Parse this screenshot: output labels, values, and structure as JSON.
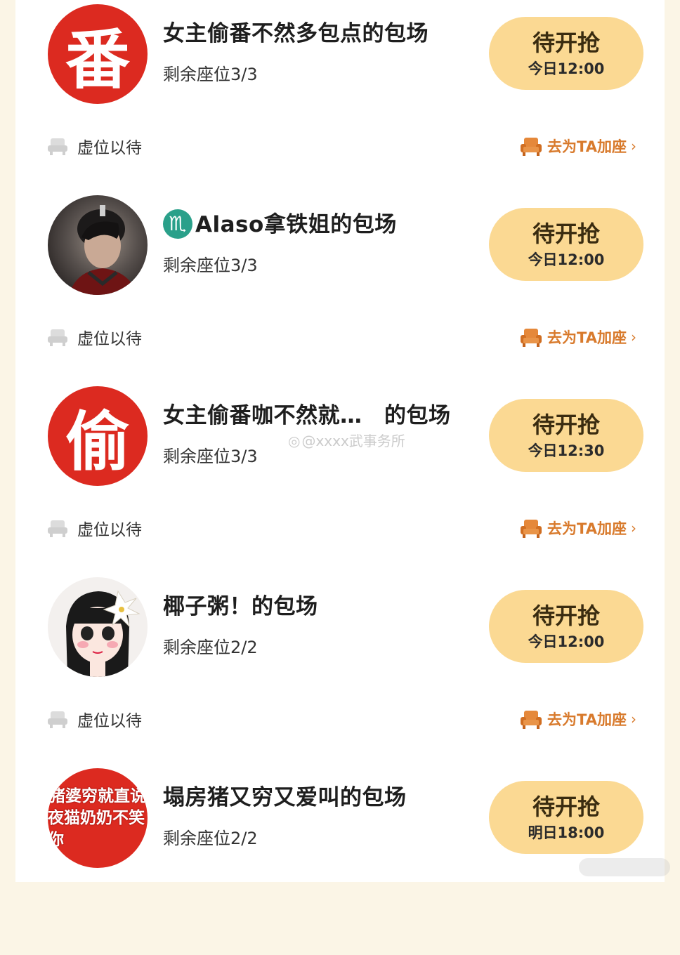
{
  "cards": [
    {
      "avatar_text": "番",
      "title": "女主偷番不然多包点的包场",
      "seats": "剩余座位3/3",
      "button_main": "待开抢",
      "button_time": "今日12:00",
      "vacant_label": "虚位以待",
      "join_label": "去为TA加座"
    },
    {
      "avatar_text": "",
      "title": "Alaso拿铁姐的包场",
      "title_icon": "♏",
      "seats": "剩余座位3/3",
      "button_main": "待开抢",
      "button_time": "今日12:00",
      "vacant_label": "虚位以待",
      "join_label": "去为TA加座"
    },
    {
      "avatar_text": "偷",
      "title": "女主偷番咖不然就…　的包场",
      "seats": "剩余座位3/3",
      "button_main": "待开抢",
      "button_time": "今日12:30",
      "vacant_label": "虚位以待",
      "join_label": "去为TA加座"
    },
    {
      "avatar_text": "",
      "title": "椰子粥！的包场",
      "seats": "剩余座位2/2",
      "button_main": "待开抢",
      "button_time": "今日12:00",
      "vacant_label": "虚位以待",
      "join_label": "去为TA加座"
    },
    {
      "avatar_line1": "猪婆穷就直说",
      "avatar_line2": "夜猫奶奶不笑你",
      "title": "塌房猪又穷又爱叫的包场",
      "seats": "剩余座位2/2",
      "button_main": "待开抢",
      "button_time": "明日18:00"
    }
  ],
  "watermark": "@xxxx武事务所",
  "colors": {
    "accent_orange": "#d87a2c",
    "button_bg": "#fbd993",
    "avatar_red": "#dc2a20",
    "page_bg": "#fbf5e6"
  },
  "icons": {
    "seat": "seat-icon",
    "sofa": "sofa-icon",
    "chevron": "chevron-right-icon",
    "weibo": "weibo-icon"
  }
}
